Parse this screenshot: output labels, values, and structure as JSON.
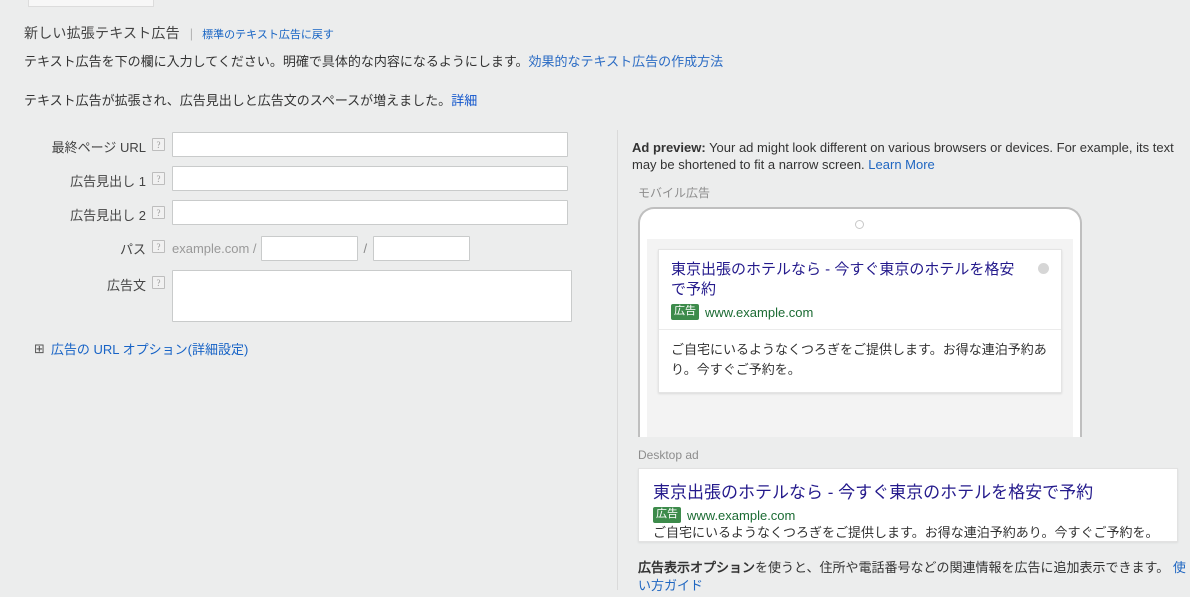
{
  "header": {
    "title": "新しい拡張テキスト広告",
    "separator": "|",
    "revert_link": "標準のテキスト広告に戻す",
    "description_1": "テキスト広告を下の欄に入力してください。明確で具体的な内容になるようにします。",
    "description_1_link": "効果的なテキスト広告の作成方法",
    "description_2": "テキスト広告が拡張され、広告見出しと広告文のスペースが増えました。",
    "description_2_link": "詳細"
  },
  "form": {
    "help_icon_glyph": "?",
    "fields": [
      {
        "label": "最終ページ URL",
        "value": "",
        "placeholder": "",
        "name": "final-url"
      },
      {
        "label": "広告見出し 1",
        "value": "",
        "placeholder": "",
        "name": "headline-1"
      },
      {
        "label": "広告見出し 2",
        "value": "",
        "placeholder": "",
        "name": "headline-2"
      }
    ],
    "path_row": {
      "label": "パス",
      "domain_prefix": "example.com /",
      "slash": "/",
      "path1_value": "",
      "path2_value": "",
      "path1_placeholder": "",
      "path2_placeholder": ""
    },
    "description_row": {
      "label": "広告文",
      "value": "",
      "placeholder": ""
    },
    "url_options": {
      "expand_icon": "⊞",
      "label": "広告の URL オプション(詳細設定)"
    }
  },
  "preview": {
    "note_label": "Ad preview:",
    "note_text": " Your ad might look different on various browsers or devices. For example, its text may be shortened to fit a narrow screen. ",
    "note_link": "Learn More",
    "mobile": {
      "caption": "モバイル広告",
      "title": "東京出張のホテルなら - 今すぐ東京のホテルを格安で予約",
      "ad_badge": "広告",
      "display_url": "www.example.com",
      "description": "ご自宅にいるようなくつろぎをご提供します。お得な連泊予約あり。今すぐご予約を。"
    },
    "desktop": {
      "caption": "Desktop ad",
      "title": "東京出張のホテルなら - 今すぐ東京のホテルを格安で予約",
      "ad_badge": "広告",
      "display_url": "www.example.com",
      "description": "ご自宅にいるようなくつろぎをご提供します。お得な連泊予約あり。今すぐご予約を。"
    },
    "footer": {
      "bold_text": "広告表示オプション",
      "text": "を使うと、住所や電話番号などの関連情報を広告に追加表示できます。 ",
      "link": "使い方ガイド"
    }
  },
  "colors": {
    "page_background": "#eceded",
    "link_blue": "#1763c6",
    "ad_badge_green": "#3d8b4b",
    "display_url_green": "#1b6b33",
    "title_purple": "#241a8c"
  }
}
